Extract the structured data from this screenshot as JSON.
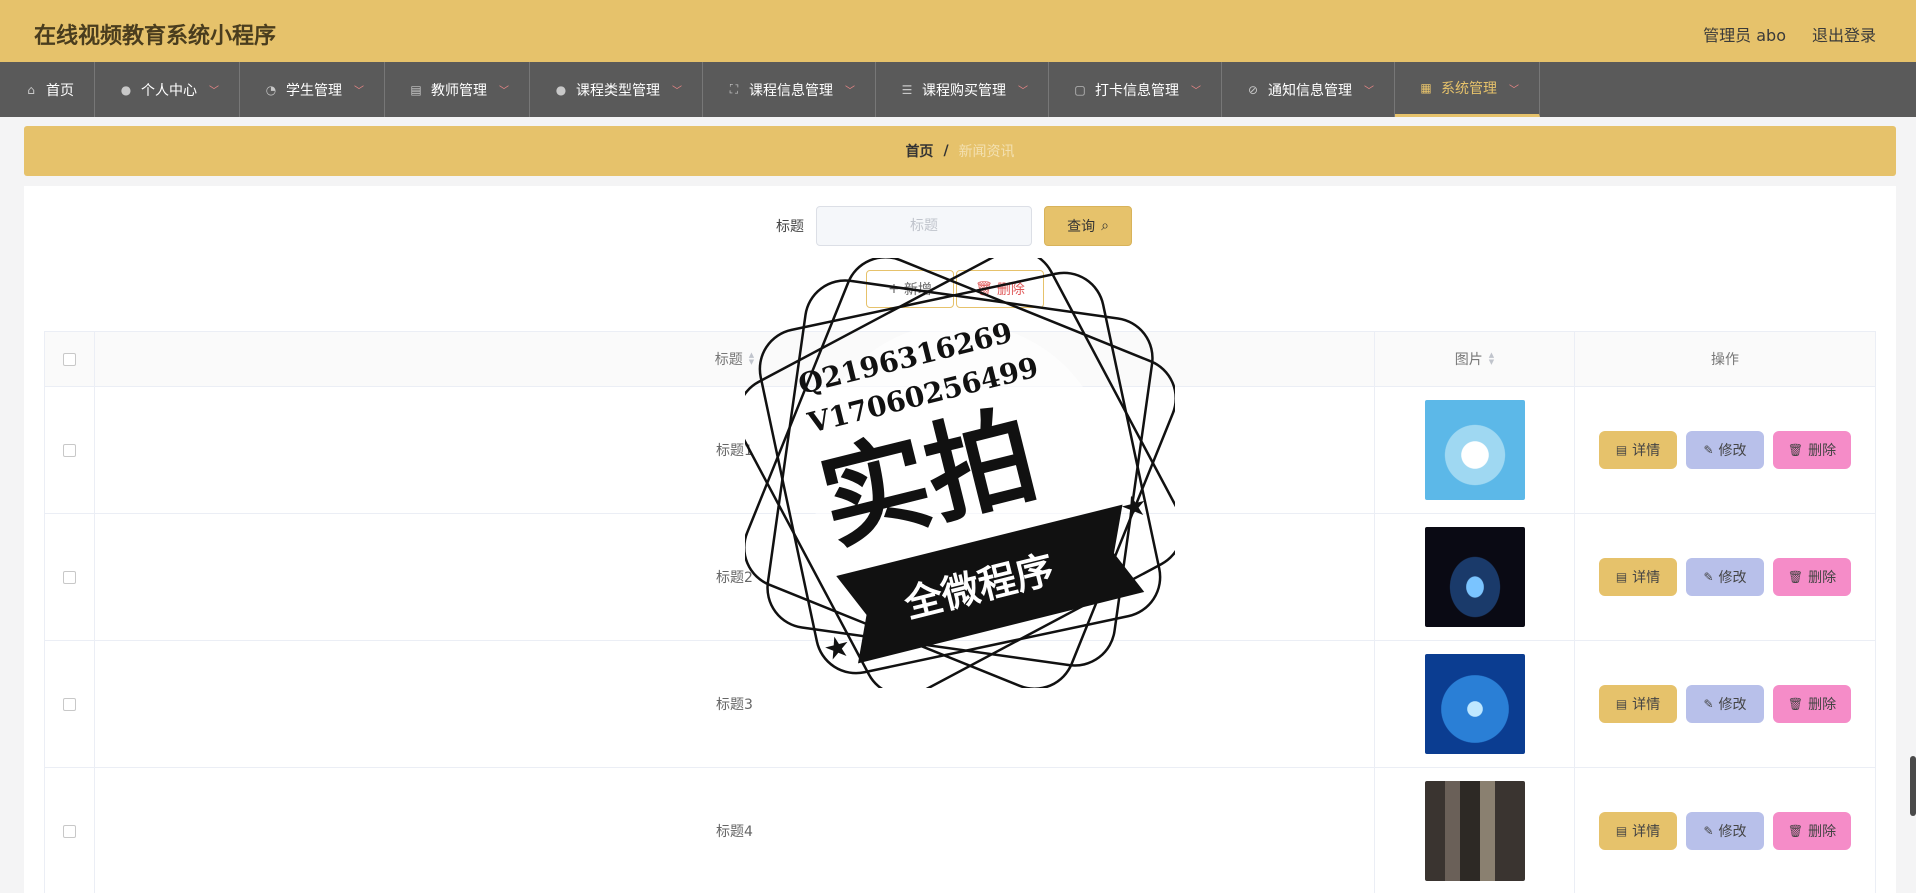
{
  "app": {
    "title": "在线视频教育系统小程序"
  },
  "header": {
    "user": "管理员 abo",
    "logout": "退出登录"
  },
  "nav": [
    {
      "label": "首页",
      "icon": "home-icon"
    },
    {
      "label": "个人中心",
      "icon": "user-icon"
    },
    {
      "label": "学生管理",
      "icon": "gauge-icon"
    },
    {
      "label": "教师管理",
      "icon": "clipboard-icon"
    },
    {
      "label": "课程类型管理",
      "icon": "user-icon"
    },
    {
      "label": "课程信息管理",
      "icon": "frame-icon"
    },
    {
      "label": "课程购买管理",
      "icon": "list-icon"
    },
    {
      "label": "打卡信息管理",
      "icon": "chat-icon"
    },
    {
      "label": "通知信息管理",
      "icon": "bell-off-icon"
    },
    {
      "label": "系统管理",
      "icon": "grid-icon"
    }
  ],
  "breadcrumb": {
    "home": "首页",
    "sep": "/",
    "current": "新闻资讯"
  },
  "search": {
    "label": "标题",
    "placeholder": "标题",
    "value": "",
    "button": "查询"
  },
  "actions": {
    "add": "新增",
    "delete": "删除"
  },
  "table": {
    "headers": {
      "title": "标题",
      "image": "图片",
      "ops": "操作"
    },
    "rows": [
      {
        "title": "标题1"
      },
      {
        "title": "标题2"
      },
      {
        "title": "标题3"
      },
      {
        "title": "标题4"
      }
    ],
    "row_actions": {
      "detail": "详情",
      "edit": "修改",
      "delete": "删除"
    }
  },
  "watermark": {
    "line1": "Q2196316269",
    "line2": "V17060256499",
    "big": "实拍",
    "ribbon": "全微程序"
  },
  "colors": {
    "accent": "#e6c26b",
    "nav_bg": "#5a5a5a",
    "edit": "#b8c0ea",
    "delete": "#f58cc8"
  }
}
